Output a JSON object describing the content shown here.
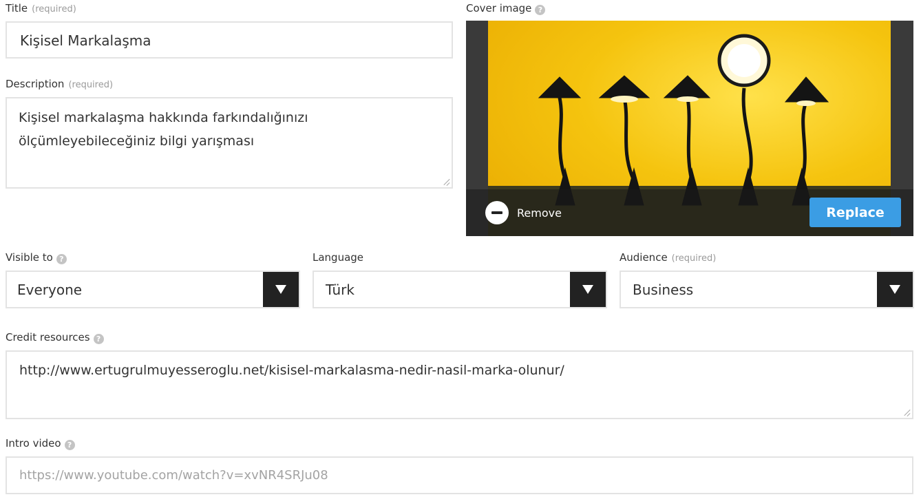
{
  "title_field": {
    "label": "Title",
    "required": "(required)",
    "value": "Kişisel Markalaşma"
  },
  "description_field": {
    "label": "Description",
    "required": "(required)",
    "line1": "Kişisel markalaşma hakkında farkındalığınızı",
    "line2": "ölçümleyebileceğiniz bilgi yarışması"
  },
  "cover_image": {
    "label": "Cover image",
    "remove_label": "Remove",
    "replace_label": "Replace",
    "icon": "lamps-photo"
  },
  "visible_to": {
    "label": "Visible to",
    "value": "Everyone"
  },
  "language": {
    "label": "Language",
    "value": "Türk"
  },
  "audience": {
    "label": "Audience",
    "required": "(required)",
    "value": "Business"
  },
  "credit_resources": {
    "label": "Credit resources",
    "value": "http://www.ertugrulmuyesseroglu.net/kisisel-markalasma-nedir-nasil-marka-olunur/"
  },
  "intro_video": {
    "label": "Intro video",
    "placeholder": "https://www.youtube.com/watch?v=xvNR4SRJu08"
  },
  "colors": {
    "accent": "#3b9de4",
    "select_button": "#222222",
    "border": "#e3e3e3"
  }
}
